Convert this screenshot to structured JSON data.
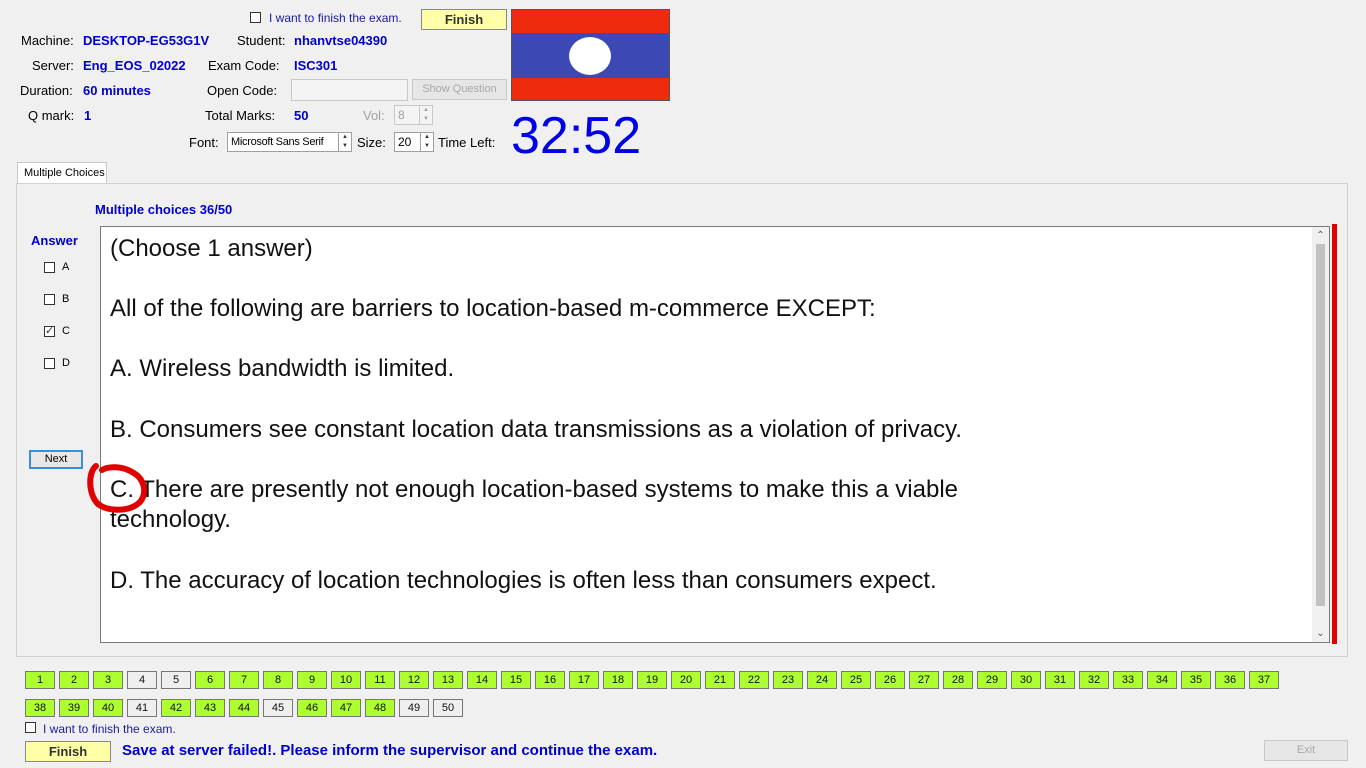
{
  "header": {
    "finish_top_check_label": "I want to finish the exam.",
    "finish_top_label": "Finish",
    "machine_label": "Machine:",
    "machine_value": "DESKTOP-EG53G1V",
    "student_label": "Student:",
    "student_value": "nhanvtse04390",
    "server_label": "Server:",
    "server_value": "Eng_EOS_02022",
    "exam_code_label": "Exam Code:",
    "exam_code_value": "ISC301",
    "duration_label": "Duration:",
    "duration_value": "60 minutes",
    "open_code_label": "Open Code:",
    "open_code_value": "",
    "show_question_label": "Show Question",
    "qmark_label": "Q mark:",
    "qmark_value": "1",
    "total_marks_label": "Total Marks:",
    "total_marks_value": "50",
    "vol_label": "Vol:",
    "vol_value": "8",
    "font_label": "Font:",
    "font_value": "Microsoft Sans Serif",
    "size_label": "Size:",
    "size_value": "20",
    "time_left_label": "Time Left:",
    "time_left_value": "32:52"
  },
  "tab": {
    "label": "Multiple Choices"
  },
  "main": {
    "progress_label": "Multiple choices 36/50",
    "answer_label": "Answer",
    "options": [
      {
        "letter": "A",
        "checked": false
      },
      {
        "letter": "B",
        "checked": false
      },
      {
        "letter": "C",
        "checked": true
      },
      {
        "letter": "D",
        "checked": false
      }
    ],
    "next_label": "Next",
    "question": {
      "instruction": "(Choose 1 answer)",
      "stem": "All of the following are barriers to location-based m-commerce EXCEPT:",
      "a": "A.  Wireless bandwidth is limited.",
      "b": "B.  Consumers see constant location data transmissions as a violation of privacy.",
      "c_line1": "C.  There are presently not enough location-based systems to make this a viable",
      "c_line2": "technology.",
      "d": "D.  The accuracy of location technologies is often less than consumers expect."
    }
  },
  "navigation": {
    "questions": [
      {
        "n": "1",
        "answered": true
      },
      {
        "n": "2",
        "answered": true
      },
      {
        "n": "3",
        "answered": true
      },
      {
        "n": "4",
        "answered": false
      },
      {
        "n": "5",
        "answered": false
      },
      {
        "n": "6",
        "answered": true
      },
      {
        "n": "7",
        "answered": true
      },
      {
        "n": "8",
        "answered": true
      },
      {
        "n": "9",
        "answered": true
      },
      {
        "n": "10",
        "answered": true
      },
      {
        "n": "11",
        "answered": true
      },
      {
        "n": "12",
        "answered": true
      },
      {
        "n": "13",
        "answered": true
      },
      {
        "n": "14",
        "answered": true
      },
      {
        "n": "15",
        "answered": true
      },
      {
        "n": "16",
        "answered": true
      },
      {
        "n": "17",
        "answered": true
      },
      {
        "n": "18",
        "answered": true
      },
      {
        "n": "19",
        "answered": true
      },
      {
        "n": "20",
        "answered": true
      },
      {
        "n": "21",
        "answered": true
      },
      {
        "n": "22",
        "answered": true
      },
      {
        "n": "23",
        "answered": true
      },
      {
        "n": "24",
        "answered": true
      },
      {
        "n": "25",
        "answered": true
      },
      {
        "n": "26",
        "answered": true
      },
      {
        "n": "27",
        "answered": true
      },
      {
        "n": "28",
        "answered": true
      },
      {
        "n": "29",
        "answered": true
      },
      {
        "n": "30",
        "answered": true
      },
      {
        "n": "31",
        "answered": true
      },
      {
        "n": "32",
        "answered": true
      },
      {
        "n": "33",
        "answered": true
      },
      {
        "n": "34",
        "answered": true
      },
      {
        "n": "35",
        "answered": true
      },
      {
        "n": "36",
        "answered": true
      },
      {
        "n": "37",
        "answered": true
      },
      {
        "n": "38",
        "answered": true
      },
      {
        "n": "39",
        "answered": true
      },
      {
        "n": "40",
        "answered": true
      },
      {
        "n": "41",
        "answered": false
      },
      {
        "n": "42",
        "answered": true
      },
      {
        "n": "43",
        "answered": true
      },
      {
        "n": "44",
        "answered": true
      },
      {
        "n": "45",
        "answered": false
      },
      {
        "n": "46",
        "answered": true
      },
      {
        "n": "47",
        "answered": true
      },
      {
        "n": "48",
        "answered": true
      },
      {
        "n": "49",
        "answered": false
      },
      {
        "n": "50",
        "answered": false
      }
    ]
  },
  "footer": {
    "finish_check_label": "I want to finish the exam.",
    "finish_label": "Finish",
    "status_message": "Save at server failed!. Please inform the supervisor and continue the exam.",
    "exit_label": "Exit"
  },
  "colors": {
    "accent_blue": "#0000cc",
    "answered_green": "#adff2f",
    "finish_yellow": "#ffffa8",
    "flag_red": "#ce1126",
    "flag_blue": "#002868"
  }
}
